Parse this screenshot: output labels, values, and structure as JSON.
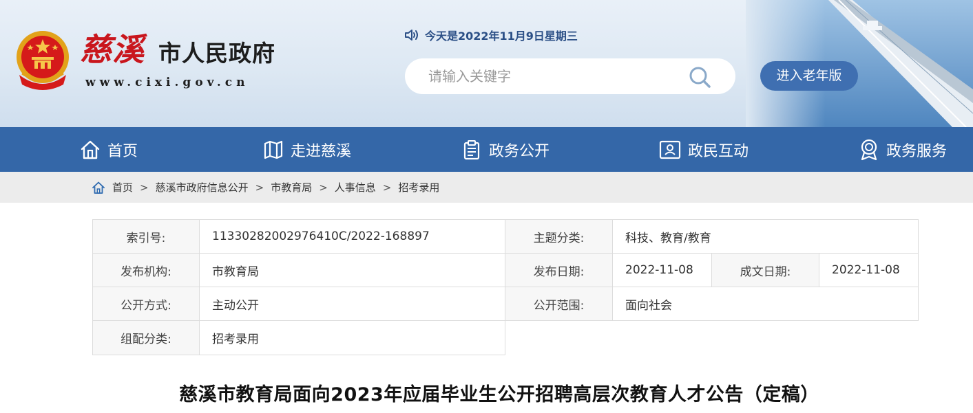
{
  "header": {
    "brand_name_a": "慈溪",
    "brand_name_b": "市人民政府",
    "site_url": "www.cixi.gov.cn",
    "date_text": "今天是2022年11月9日星期三",
    "search_placeholder": "请输入关键字",
    "elder_button": "进入老年版"
  },
  "nav": {
    "items": [
      {
        "label": "首页",
        "icon": "home-icon"
      },
      {
        "label": "走进慈溪",
        "icon": "map-icon"
      },
      {
        "label": "政务公开",
        "icon": "clipboard-icon"
      },
      {
        "label": "政民互动",
        "icon": "user-card-icon"
      },
      {
        "label": "政务服务",
        "icon": "badge-icon"
      }
    ]
  },
  "breadcrumb": [
    "首页",
    "慈溪市政府信息公开",
    "市教育局",
    "人事信息",
    "招考录用"
  ],
  "info": {
    "index_label": "索引号:",
    "index_value": "11330282002976410C/2022-168897",
    "topic_label": "主题分类:",
    "topic_value": "科技、教育/教育",
    "publisher_label": "发布机构:",
    "publisher_value": "市教育局",
    "pubdate_label": "发布日期:",
    "pubdate_value": "2022-11-08",
    "writedate_label": "成文日期:",
    "writedate_value": "2022-11-08",
    "method_label": "公开方式:",
    "method_value": "主动公开",
    "scope_label": "公开范围:",
    "scope_value": "面向社会",
    "category_label": "组配分类:",
    "category_value": "招考录用"
  },
  "article": {
    "title": "慈溪市教育局面向2023年应届毕业生公开招聘高层次教育人才公告（定稿）"
  },
  "colors": {
    "nav_bg": "#3467a8",
    "elder_button_bg": "#3f6fb1",
    "brand_red": "#c9161d"
  }
}
